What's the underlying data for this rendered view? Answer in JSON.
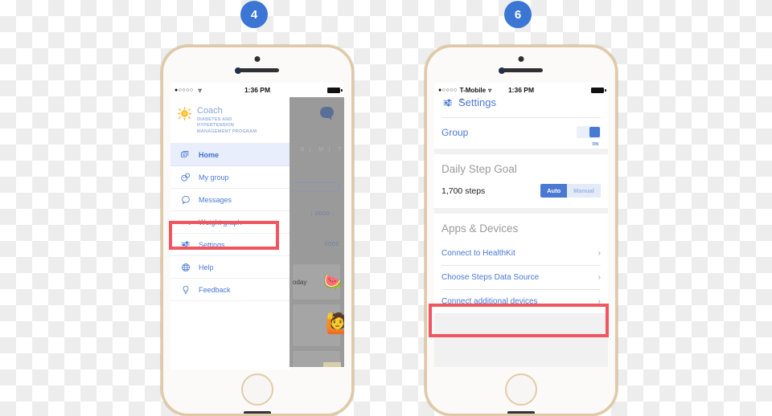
{
  "badges": {
    "left": "4",
    "right": "6"
  },
  "left_phone": {
    "status_bar": {
      "signal_dots": "●○○○○",
      "carrier": "",
      "wifi_icon": "wifi-icon",
      "time": "1:36 PM"
    },
    "brand": {
      "icon": "sun-icon",
      "title": "Coach",
      "subtitle_line1": "DIABETES AND",
      "subtitle_line2": "HYPERTENSION",
      "subtitle_line3": "MANAGEMENT PROGRAM"
    },
    "menu": [
      {
        "label": "Home",
        "icon": "home-cards-icon",
        "active": true
      },
      {
        "label": "My group",
        "icon": "group-chat-icon",
        "active": false
      },
      {
        "label": "Messages",
        "icon": "message-icon",
        "active": false
      },
      {
        "label": "Weight graph",
        "icon": "line-graph-icon",
        "active": false
      },
      {
        "label": "Settings",
        "icon": "sliders-icon",
        "active": false
      },
      {
        "label": "Help",
        "icon": "globe-help-icon",
        "active": false
      },
      {
        "label": "Feedback",
        "icon": "lightbulb-icon",
        "active": false
      }
    ],
    "dimmed_panel": {
      "day_labels": [
        "S",
        "M",
        "T"
      ],
      "number_1": "0000",
      "number_2": "0000",
      "today_label": "oday",
      "emoji_1": "🍉",
      "emoji_2": "🙋",
      "bubble_icon": "chat-bubble-icon"
    }
  },
  "right_phone": {
    "status_bar": {
      "signal_dots": "●○○○○",
      "carrier": "T-Mobile",
      "wifi_icon": "wifi-icon",
      "time": "1:36 PM"
    },
    "header": {
      "icon": "sliders-icon",
      "title": "Settings"
    },
    "group_row": {
      "label": "Group",
      "toggle_state": "ON",
      "toggle_caption": "ON"
    },
    "step_goal": {
      "section_title": "Daily Step Goal",
      "value": "1,700 steps",
      "mode_auto": "Auto",
      "mode_manual": "Manual",
      "selected_mode": "Auto"
    },
    "apps_devices": {
      "section_title": "Apps & Devices",
      "rows": [
        {
          "label": "Connect to HealthKit",
          "chevron": "chevron-right-icon",
          "highlighted": false
        },
        {
          "label": "Choose Steps Data Source",
          "chevron": "chevron-right-icon",
          "highlighted": false
        },
        {
          "label": "Connect additional devices",
          "chevron": "chevron-right-icon",
          "highlighted": true
        }
      ]
    }
  },
  "colors": {
    "accent_blue": "#4a79d4",
    "badge_blue": "#3b76d4",
    "highlight_red": "#f1555f",
    "phone_gold": "#e0c9a6"
  }
}
